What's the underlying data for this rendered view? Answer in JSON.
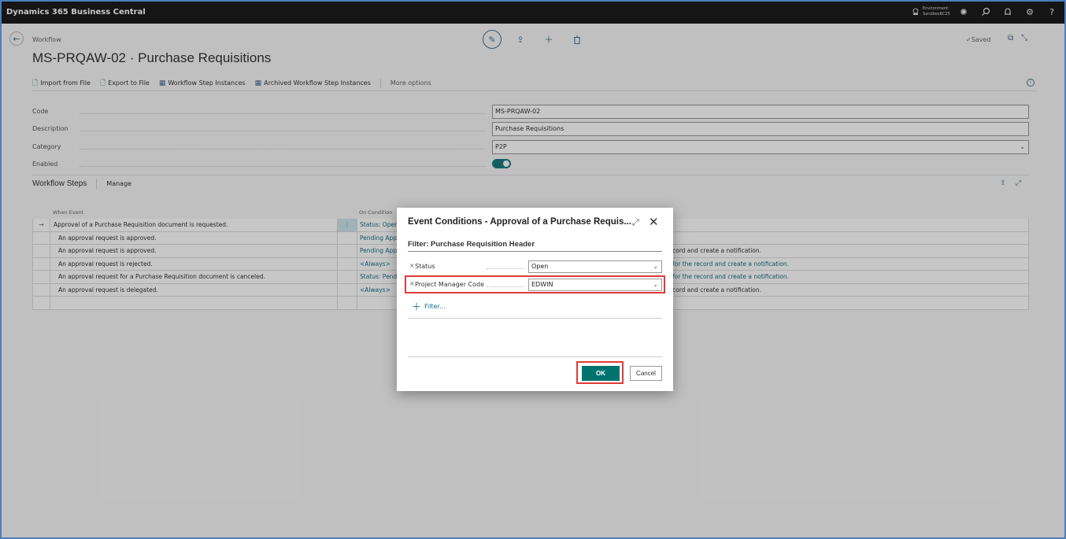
{
  "topbar": {
    "brand": "Dynamics 365 Business Central",
    "env_label": "Environment:",
    "env_name": "SandboxBC25"
  },
  "header": {
    "breadcrumb": "Workflow",
    "title": "MS-PRQAW-02 · Purchase Requisitions",
    "saved": "Saved"
  },
  "actions": {
    "import": "Import from File",
    "export": "Export to File",
    "step_instances": "Workflow Step Instances",
    "archived": "Archived Workflow Step Instances",
    "more": "More options"
  },
  "fields": {
    "code_label": "Code",
    "code_value": "MS-PRQAW-02",
    "description_label": "Description",
    "description_value": "Purchase Requisitions",
    "category_label": "Category",
    "category_value": "P2P",
    "enabled_label": "Enabled"
  },
  "steps": {
    "title": "Workflow Steps",
    "manage": "Manage",
    "col_when": "When Event",
    "col_on": "On Condition",
    "rows": [
      {
        "event": "Approval of a Purchase Requisition document is requested.",
        "cond": "Status: Open,",
        "resp": ""
      },
      {
        "event": "An approval request is approved.",
        "cond": "Pending App",
        "resp": ""
      },
      {
        "event": "An approval request is approved.",
        "cond": "Pending App",
        "resp": "cord and create a notification."
      },
      {
        "event": "An approval request is rejected.",
        "cond": "<Always>",
        "resp": "for the record and create a notification."
      },
      {
        "event": "An approval request for a Purchase Requisition document is canceled.",
        "cond": "Status: Pendi",
        "resp": "for the record and create a notification."
      },
      {
        "event": "An approval request is delegated.",
        "cond": "<Always>",
        "resp": "cord and create a notification."
      }
    ]
  },
  "dialog": {
    "title": "Event Conditions - Approval of a Purchase Requis...",
    "subtitle": "Filter: Purchase Requisition Header",
    "filters": [
      {
        "label": "Status",
        "value": "Open"
      },
      {
        "label": "Project Manager Code",
        "value": "EDWIN"
      }
    ],
    "add_filter": "Filter...",
    "ok": "OK",
    "cancel": "Cancel"
  },
  "colors": {
    "accent": "#00736e",
    "link": "#1a6e80",
    "highlight": "#e03a3a"
  }
}
